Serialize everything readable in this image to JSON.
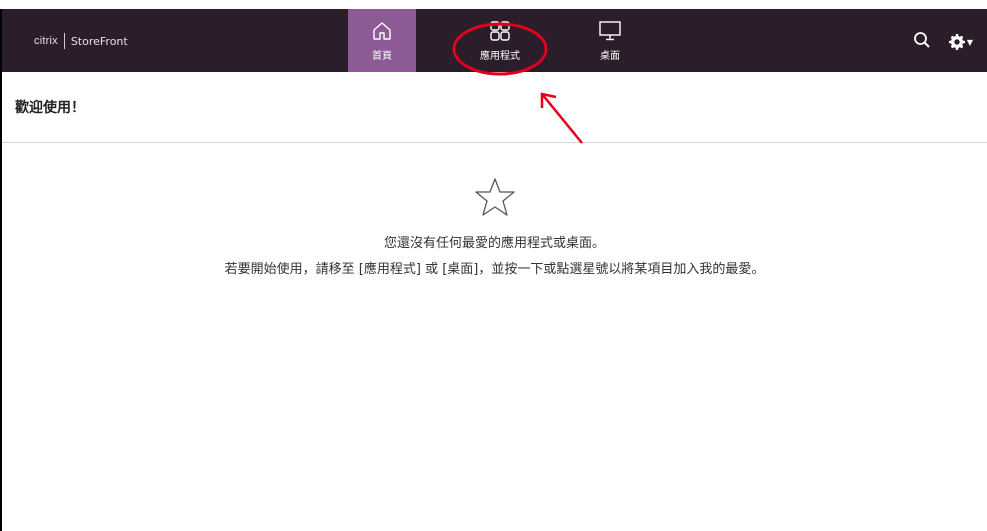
{
  "brand": {
    "logo_text": "citrix",
    "product": "StoreFront"
  },
  "nav": {
    "tabs": [
      {
        "label": "首頁",
        "icon": "home-icon",
        "active": true
      },
      {
        "label": "應用程式",
        "icon": "apps-grid-icon",
        "active": false
      },
      {
        "label": "桌面",
        "icon": "desktop-monitor-icon",
        "active": false
      }
    ]
  },
  "header_actions": {
    "search_icon": "search-icon",
    "settings_icon": "gear-icon"
  },
  "welcome": {
    "title": "歡迎使用！"
  },
  "empty_state": {
    "icon": "star-icon",
    "line1": "您還沒有任何最愛的應用程式或桌面。",
    "line2": "若要開始使用，請移至 [應用程式] 或 [桌面]，並按一下或點選星號以將某項目加入我的最愛。"
  },
  "colors": {
    "navbar": "#2c1d2b",
    "active_tab": "#8c5a94",
    "annotation": "#e0001b"
  }
}
